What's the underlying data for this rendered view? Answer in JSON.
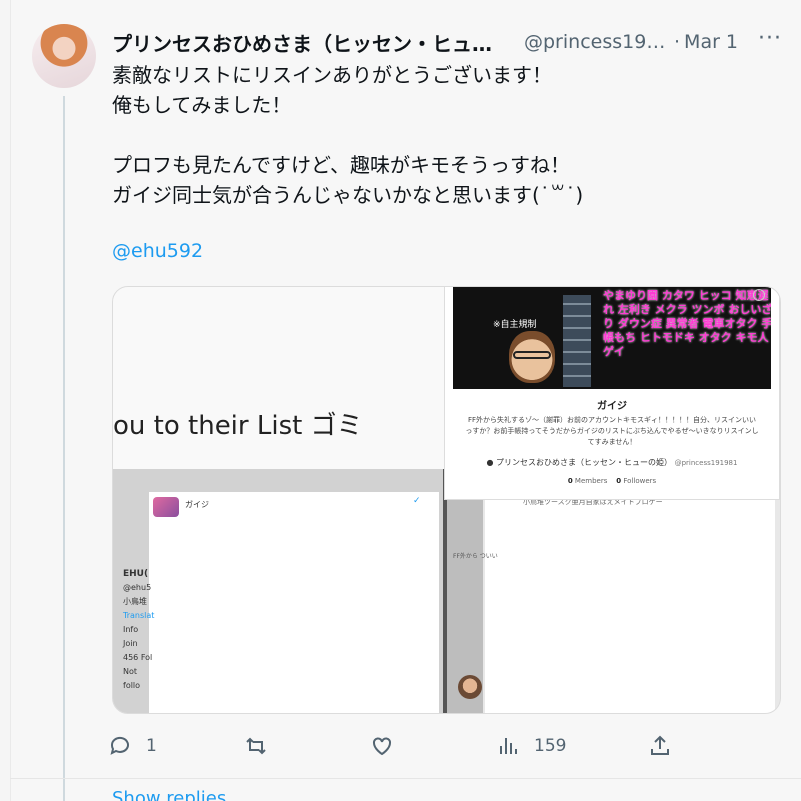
{
  "tweet": {
    "display_name": "プリンセスおひめさま（ヒッセン・ヒュー...",
    "handle": "@princess191...",
    "separator": "·",
    "date": "Mar 1",
    "more_icon": "more-horizontal-icon",
    "more_label": "···",
    "lines": [
      "素敵なリストにリスインありがとうございます！",
      "俺もしてみました！",
      "",
      "プロフも見たんですけど、趣味がキモそうっすね！",
      "ガイジ同士気が合うんじゃないかなと思います(˙꒳˙)"
    ],
    "mention": "@ehu592"
  },
  "media": {
    "left_text": "ou to their List ゴミ",
    "banner_caption": "※自主規制",
    "banner_words": "やまゆり園 カタワ ヒッコ 知恵遅れ 左利き メクラ ツンボ おしいざり ダウン症 異常者 電車オタク 手帳もち ヒトモドキ オタク キモ人 ゲイ",
    "list_name": "ガイジ",
    "list_description": "FF外から失礼するゾ～（謝罪）お前のアカウントキモスギィ！！！！！自分、リスインいいっすか？お前手帳持ってそうだからガイジのリストにぶち込んでやるぜ～いきなりリスインしてすみません！",
    "owner_name": "プリンセスおひめさま（ヒッセン・ヒューの姫）",
    "owner_handle": "@princess191981",
    "members_count": "0",
    "members_label": "Members",
    "followers_count": "0",
    "followers_label": "Followers",
    "mini_profile": {
      "name": "EHU(",
      "handle": "@ehu5",
      "bio": "小鳥堆",
      "translate": "Translat",
      "info": "Info",
      "joined": "Join",
      "following": "456 Fol",
      "not_following": "Not follo"
    },
    "mini_list_name": "ガイジ",
    "right_snippet": "小鳥堆ツースク亜月自家ほえメイトプロゲー",
    "right_snippet2": "FF外から\nついい"
  },
  "actions": {
    "reply_icon": "reply-icon",
    "reply_count": "1",
    "retweet_icon": "retweet-icon",
    "like_icon": "heart-icon",
    "views_icon": "views-icon",
    "views_count": "159",
    "share_icon": "share-icon"
  },
  "footer": {
    "show_more": "Show replies"
  },
  "colors": {
    "link": "#1d9bf0",
    "muted": "#536471",
    "text": "#0f1419",
    "banner_word": "#ff3ad4"
  }
}
